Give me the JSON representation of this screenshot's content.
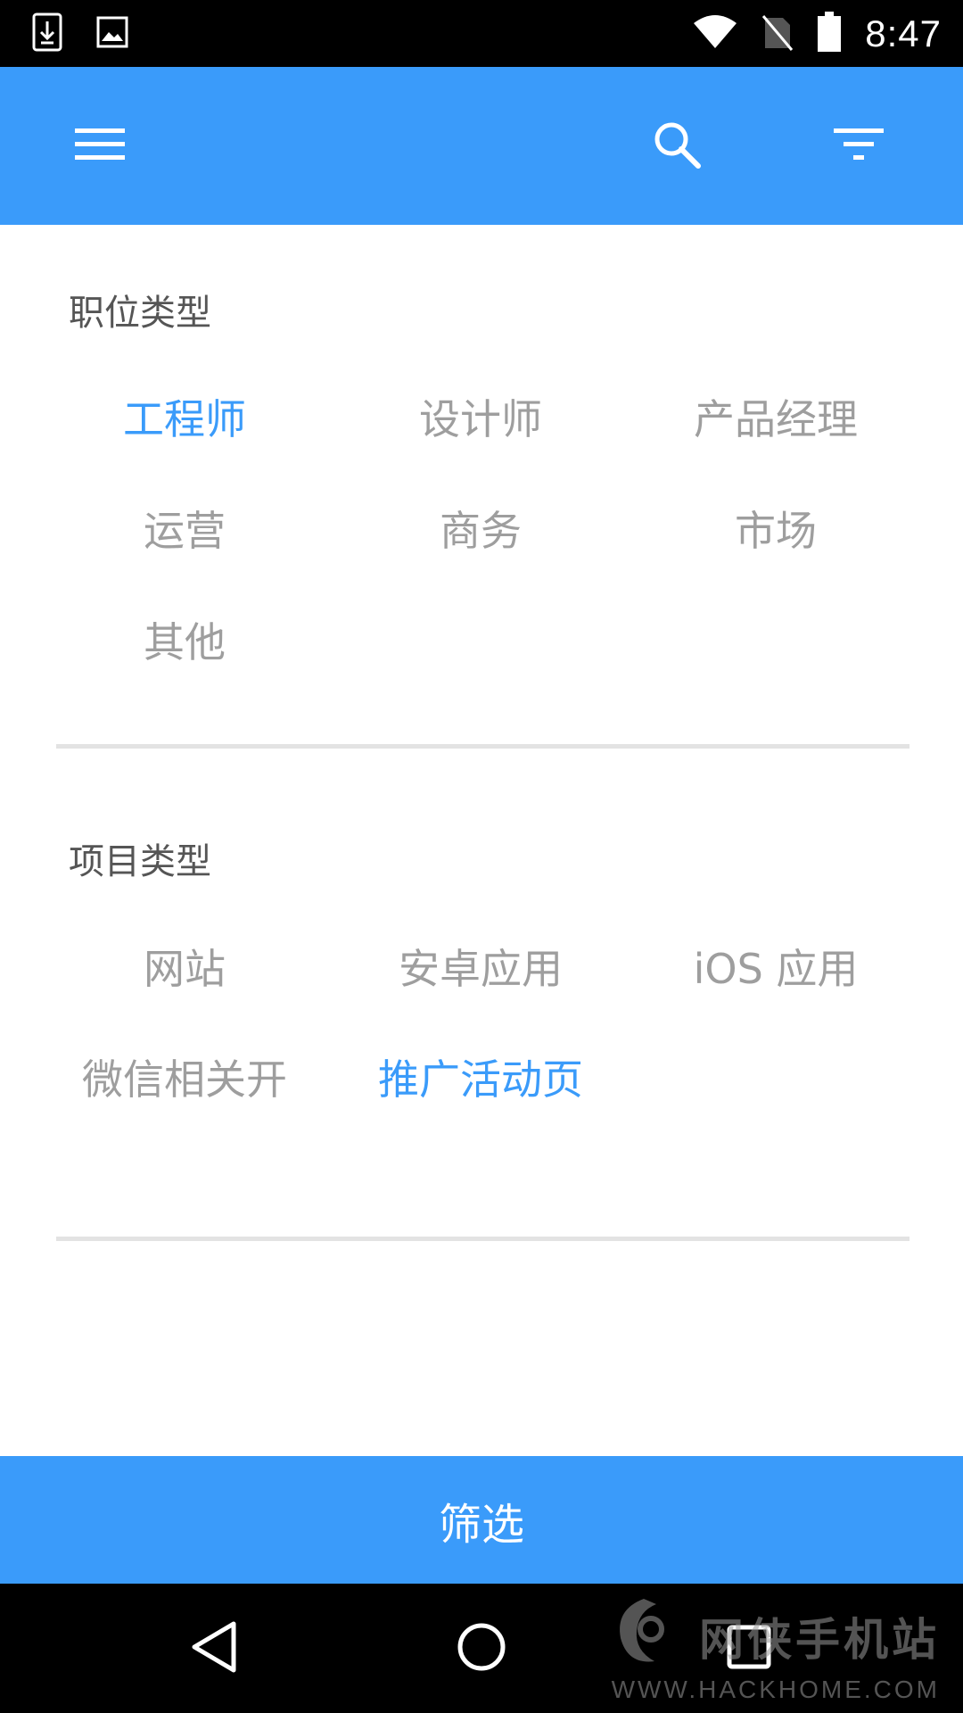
{
  "status_bar": {
    "time": "8:47",
    "icons": [
      "download-icon",
      "image-icon",
      "wifi-icon",
      "no-sim-icon",
      "battery-icon"
    ]
  },
  "app_bar": {
    "icons": [
      "menu-icon",
      "search-icon",
      "filter-icon"
    ],
    "background": "#3a9bfa"
  },
  "job_type": {
    "title": "职位类型",
    "options": [
      {
        "label": "工程师",
        "selected": true
      },
      {
        "label": "设计师",
        "selected": false
      },
      {
        "label": "产品经理",
        "selected": false
      },
      {
        "label": "运营",
        "selected": false
      },
      {
        "label": "商务",
        "selected": false
      },
      {
        "label": "市场",
        "selected": false
      },
      {
        "label": "其他",
        "selected": false
      }
    ]
  },
  "project_type": {
    "title": "项目类型",
    "options": [
      {
        "label": "网站",
        "selected": false
      },
      {
        "label": "安卓应用",
        "selected": false
      },
      {
        "label": "iOS 应用",
        "selected": false
      },
      {
        "label": "微信相关开",
        "selected": false
      },
      {
        "label": "推广活动页",
        "selected": true
      }
    ]
  },
  "submit": {
    "label": "筛选"
  },
  "nav_bar": {
    "icons": [
      "back-icon",
      "home-icon",
      "recent-apps-icon"
    ]
  },
  "watermark": {
    "title": "网侠手机站",
    "url": "WWW.HACKHOME.COM"
  },
  "colors": {
    "accent": "#3a9bfa",
    "option_text": "#9e9e9e",
    "section_title": "#555555",
    "divider": "#e3e3e3"
  }
}
